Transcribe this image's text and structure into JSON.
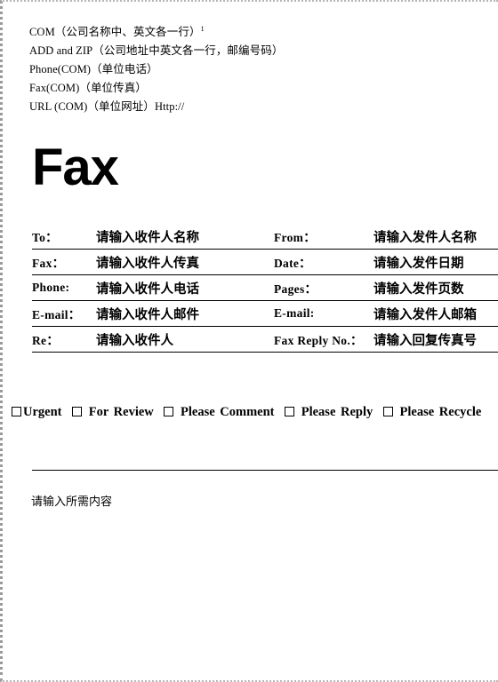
{
  "letterhead": {
    "lines": [
      "COM（公司名称中、英文各一行）",
      "ADD and ZIP（公司地址中英文各一行，邮编号码）",
      "Phone(COM)（单位电话）",
      "Fax(COM)（单位传真）",
      "URL (COM)（单位网址）Http://"
    ],
    "footnote_marker": "1"
  },
  "title": "Fax",
  "info_table": {
    "rows": [
      {
        "left_label": "To：",
        "left_value": "请输入收件人名称",
        "right_label": "From：",
        "right_value": "请输入发件人名称"
      },
      {
        "left_label": "Fax：",
        "left_value": "请输入收件人传真",
        "right_label": "Date：",
        "right_value": "请输入发件日期"
      },
      {
        "left_label": "Phone:",
        "left_value": "请输入收件人电话",
        "right_label": "Pages：",
        "right_value": "请输入发件页数"
      },
      {
        "left_label": "E-mail：",
        "left_value": "请输入收件人邮件",
        "right_label": "E-mail:",
        "right_value": "请输入发件人邮箱"
      },
      {
        "left_label": "Re：",
        "left_value": "请输入收件人",
        "right_label": "Fax Reply No.：",
        "right_value": "请输入回复传真号"
      }
    ]
  },
  "checkboxes": [
    {
      "label": "Urgent",
      "checked": false
    },
    {
      "label": "For Review",
      "checked": false
    },
    {
      "label": "Please  Comment",
      "checked": false
    },
    {
      "label": "Please  Reply",
      "checked": false
    },
    {
      "label": "Please  Recycle",
      "checked": false
    }
  ],
  "body": {
    "placeholder": "请输入所需内容"
  },
  "colors": {
    "text": "#000000",
    "rule": "#000000",
    "page_border": "#b6b6b6",
    "background": "#ffffff"
  }
}
